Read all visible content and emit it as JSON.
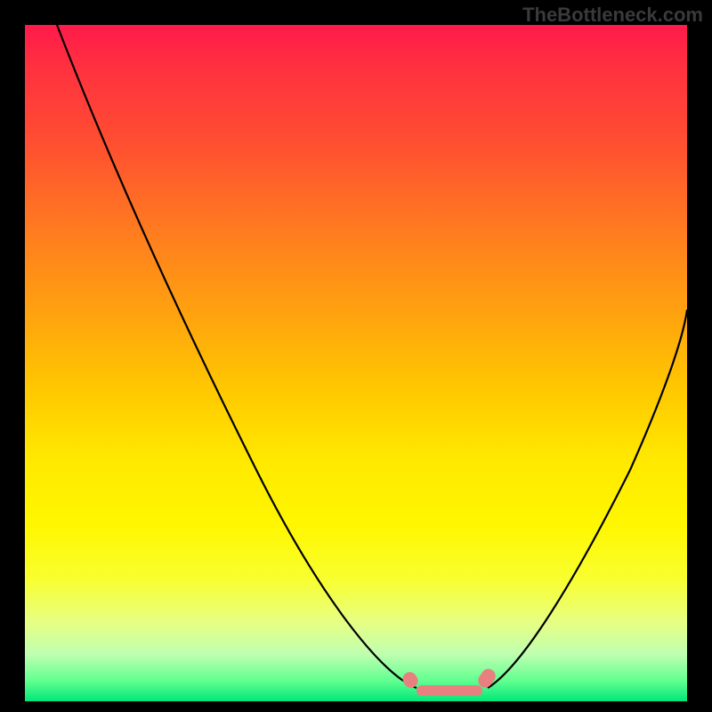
{
  "watermark": "TheBottleneck.com",
  "chart_data": {
    "type": "line",
    "title": "",
    "xlabel": "",
    "ylabel": "",
    "xlim": [
      0,
      100
    ],
    "ylim": [
      0,
      100
    ],
    "background_gradient": {
      "top": "#ff1a4a",
      "bottom": "#00e878",
      "meaning": "red high to green low"
    },
    "series": [
      {
        "name": "bottleneck-curve",
        "x": [
          5,
          10,
          15,
          20,
          25,
          30,
          35,
          40,
          45,
          50,
          55,
          58,
          60,
          62,
          65,
          68,
          70,
          75,
          80,
          85,
          90,
          95,
          100
        ],
        "y": [
          100,
          92,
          84,
          76,
          68,
          60,
          52,
          44,
          36,
          28,
          18,
          10,
          5,
          2,
          1,
          1,
          2,
          8,
          18,
          30,
          42,
          52,
          60
        ]
      }
    ],
    "annotations": [
      {
        "name": "optimal-zone",
        "x_start": 58,
        "x_end": 72,
        "color": "#e88080"
      }
    ]
  }
}
